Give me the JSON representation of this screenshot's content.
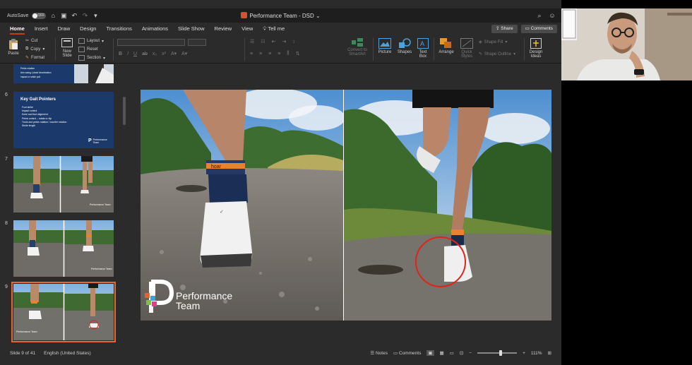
{
  "titlebar": {
    "autosave_label": "AutoSave",
    "autosave_state": "OFF",
    "document_title": "Performance Team - DSD"
  },
  "tabs": [
    {
      "label": "Home",
      "active": true
    },
    {
      "label": "Insert"
    },
    {
      "label": "Draw"
    },
    {
      "label": "Design"
    },
    {
      "label": "Transitions"
    },
    {
      "label": "Animations"
    },
    {
      "label": "Slide Show"
    },
    {
      "label": "Review"
    },
    {
      "label": "View"
    },
    {
      "label": "Tell me"
    }
  ],
  "share_label": "Share",
  "comments_label": "Comments",
  "ribbon": {
    "paste": "Paste",
    "cut": "Cut",
    "copy": "Copy",
    "format": "Format",
    "new_slide_line1": "New",
    "new_slide_line2": "Slide",
    "layout": "Layout",
    "reset": "Reset",
    "section": "Section",
    "convert_line1": "Convert to",
    "convert_line2": "SmartArt",
    "picture": "Picture",
    "shapes": "Shapes",
    "textbox_line1": "Text",
    "textbox_line2": "Box",
    "arrange": "Arrange",
    "quick_styles_line1": "Quick",
    "quick_styles_line2": "Styles",
    "shape_fill": "Shape Fill",
    "shape_outline": "Shape Outline",
    "design_ideas_line1": "Design",
    "design_ideas_line2": "Ideas"
  },
  "thumbnails": {
    "slide6": {
      "number": "6",
      "title": "Key Gait Pointers",
      "bullets": [
        "Foot strike",
        "Impact control",
        "Knee and foot alignment",
        "Pelvis control – rotate or dip",
        "Trunk and pelvis rotation / counter rotation",
        "Stride length"
      ],
      "brand": "Performance Team"
    },
    "slide7": {
      "number": "7",
      "brand": "Performance Team"
    },
    "slide8": {
      "number": "8",
      "brand": "Performance Team"
    },
    "slide9": {
      "number": "9",
      "brand": "Performance Team"
    },
    "slide5_partial_bullets": [
      "Pelvis rotation",
      "Arm swing / plant/ deceleration",
      "Impact or stride pull"
    ]
  },
  "slide": {
    "brand_line1": "Performance",
    "brand_line2": "Team",
    "sock_text": "hoar"
  },
  "statusbar": {
    "slide_position": "Slide 9 of 41",
    "language": "English (United States)",
    "notes": "Notes",
    "comments": "Comments",
    "zoom": "111%",
    "zoom_level": 0.55
  },
  "colors": {
    "accent": "#c43e1c",
    "selection": "#e8672e",
    "thumb_navy": "#1b3a6b",
    "annotation_circle": "#e0241b"
  }
}
